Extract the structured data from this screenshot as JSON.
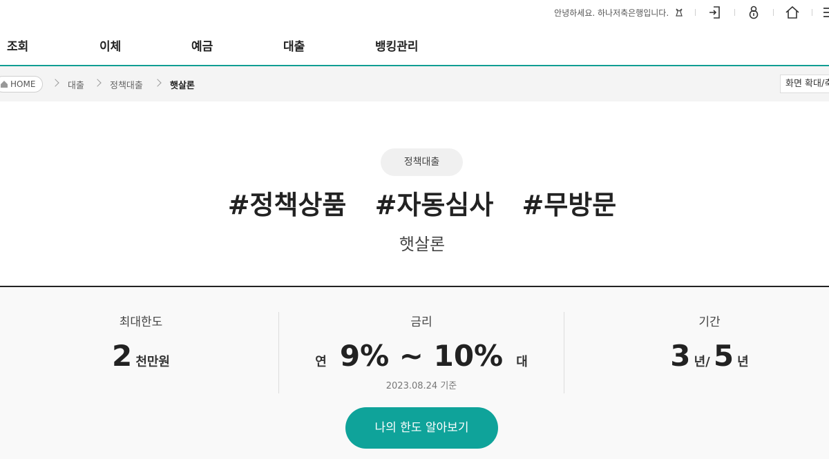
{
  "util": {
    "greeting": "안녕하세요. 하나저축은행입니다.",
    "icons": [
      "login-icon",
      "lock-icon",
      "home-icon",
      "menu-icon"
    ]
  },
  "gnb": {
    "items": [
      "조회",
      "이체",
      "예금",
      "대출",
      "뱅킹관리"
    ]
  },
  "breadcrumb": {
    "home": "HOME",
    "items": [
      "대출",
      "정책대출"
    ],
    "current": "햇살론",
    "zoom_label": "화면 확대/축소"
  },
  "hero": {
    "category": "정책대출",
    "hashtags": [
      "#정책상품",
      "#자동심사",
      "#무방문"
    ],
    "product_name": "햇살론"
  },
  "summary": {
    "limit": {
      "label": "최대한도",
      "value": "2",
      "unit": "천만원"
    },
    "rate": {
      "label": "금리",
      "prefix": "연",
      "value": "9% ~ 10%",
      "suffix": "대",
      "basis": "2023.08.24 기준"
    },
    "term": {
      "label": "기간",
      "value1": "3",
      "unit1": "년/",
      "value2": "5",
      "unit2": "년"
    }
  },
  "cta": {
    "label": "나의 한도 알아보기"
  },
  "colors": {
    "accent": "#0fa39a",
    "gnb_line": "#0f9d92"
  }
}
